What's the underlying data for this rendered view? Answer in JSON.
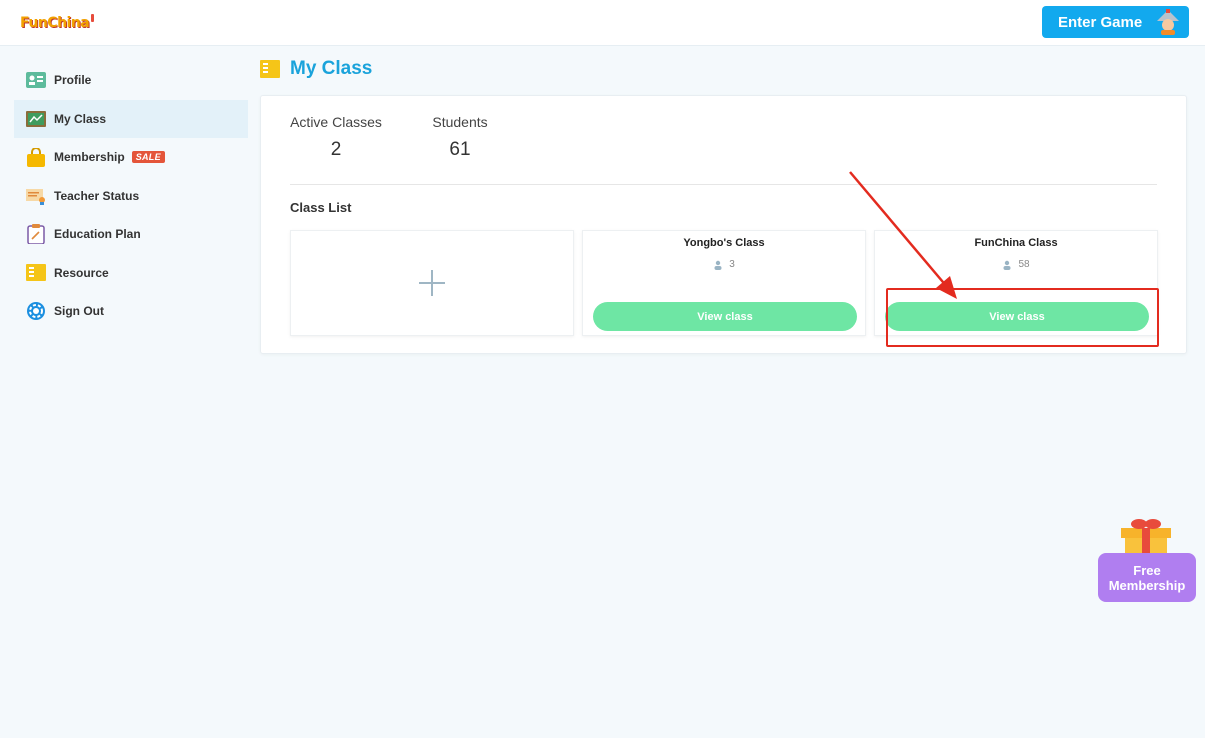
{
  "header": {
    "logo_text": "FunChina",
    "enter_game_label": "Enter Game"
  },
  "sidebar": {
    "items": [
      {
        "label": "Profile",
        "icon": "profile-card-icon"
      },
      {
        "label": "My Class",
        "icon": "classroom-board-icon",
        "active": true
      },
      {
        "label": "Membership",
        "icon": "shopping-bag-icon",
        "badge": "SALE"
      },
      {
        "label": "Teacher Status",
        "icon": "certificate-icon"
      },
      {
        "label": "Education Plan",
        "icon": "clipboard-icon"
      },
      {
        "label": "Resource",
        "icon": "folder-book-icon"
      },
      {
        "label": "Sign Out",
        "icon": "gear-icon"
      }
    ]
  },
  "main": {
    "title": "My Class",
    "stats": {
      "active_classes_label": "Active Classes",
      "active_classes_value": "2",
      "students_label": "Students",
      "students_value": "61"
    },
    "class_list_label": "Class List",
    "classes": [
      {
        "name": "Yongbo's Class",
        "student_count": "3",
        "button_label": "View class"
      },
      {
        "name": "FunChina Class",
        "student_count": "58",
        "button_label": "View class"
      }
    ]
  },
  "promo": {
    "label_line1": "Free",
    "label_line2": "Membership"
  },
  "colors": {
    "accent_blue": "#12a9ee",
    "title_blue": "#1aa3db",
    "button_green": "#6ee6a4",
    "annotation_red": "#e32b1f",
    "promo_purple": "#b07ef0"
  }
}
